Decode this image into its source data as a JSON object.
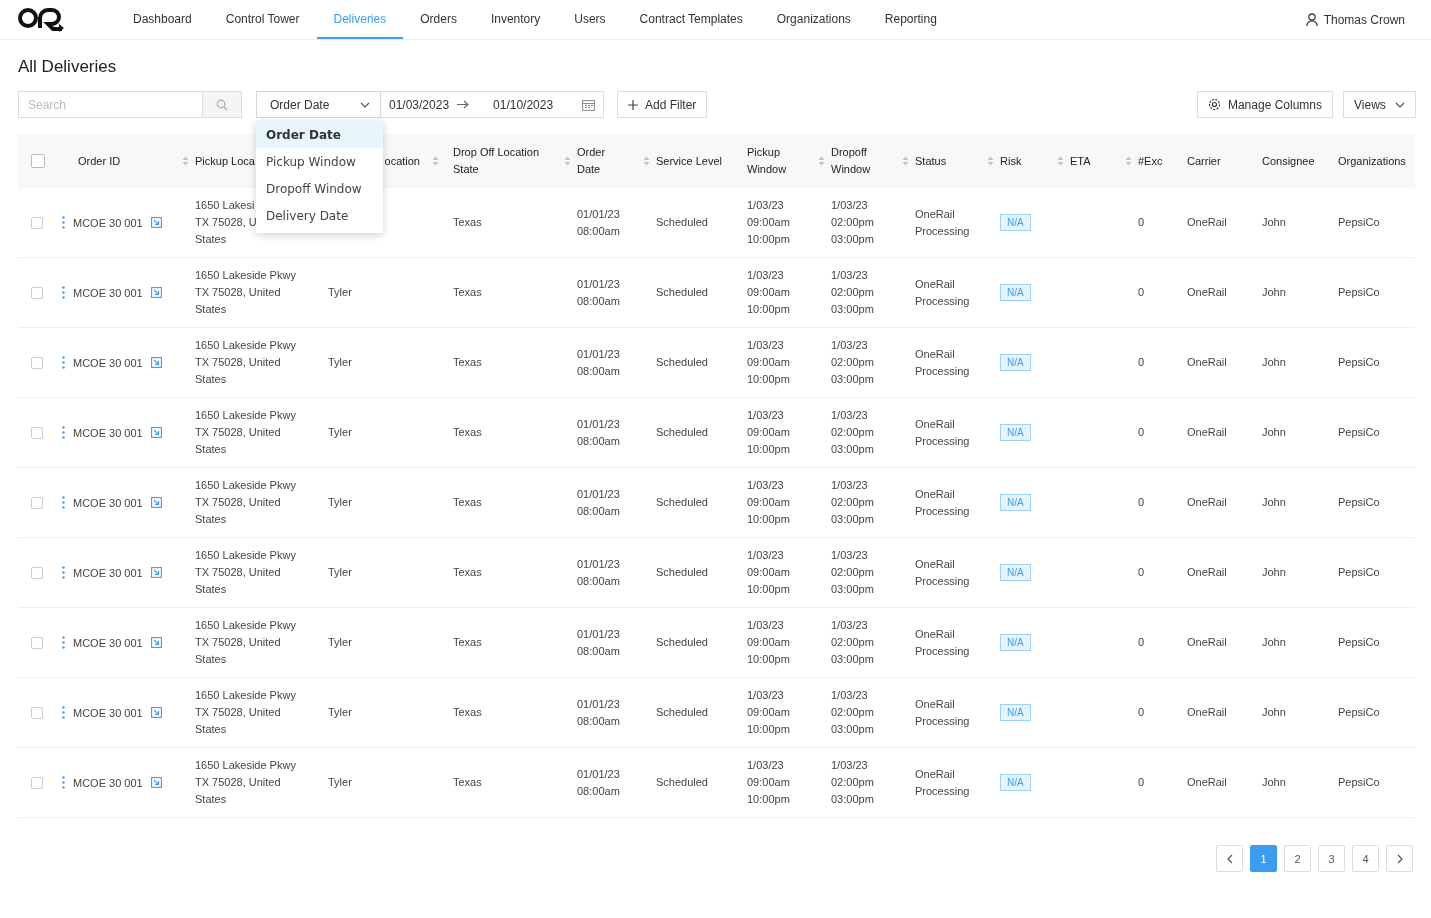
{
  "nav": {
    "items": [
      {
        "label": "Dashboard",
        "selected": false
      },
      {
        "label": "Control Tower",
        "selected": false
      },
      {
        "label": "Deliveries",
        "selected": true
      },
      {
        "label": "Orders",
        "selected": false
      },
      {
        "label": "Inventory",
        "selected": false
      },
      {
        "label": "Users",
        "selected": false
      },
      {
        "label": "Contract Templates",
        "selected": false
      },
      {
        "label": "Organizations",
        "selected": false
      },
      {
        "label": "Reporting",
        "selected": false
      }
    ],
    "user": "Thomas Crown"
  },
  "page_title": "All Deliveries",
  "toolbar": {
    "search": {
      "placeholder": "Search"
    },
    "date_field": {
      "value": "Order Date",
      "expanded": true,
      "options": [
        {
          "label": "Order Date",
          "selected": true
        },
        {
          "label": "Pickup Window",
          "selected": false
        },
        {
          "label": "Dropoff Window",
          "selected": false
        },
        {
          "label": "Delivery Date",
          "selected": false
        }
      ]
    },
    "date_from": "01/03/2023",
    "date_to": "01/10/2023",
    "add_filter": "Add Filter",
    "manage_columns": "Manage Columns",
    "views": "Views"
  },
  "table": {
    "select_all": {
      "checked": false
    },
    "columns": [
      {
        "label": "Order ID",
        "sortable": true,
        "cut": false
      },
      {
        "label": "Pickup Loca",
        "cut": false
      },
      {
        "label": "ocation",
        "sortable": true,
        "cut": true
      },
      {
        "label": "Drop Off Location\nState",
        "sortable": true,
        "cut": false
      },
      {
        "label": "Order\nDate",
        "sortable": true,
        "cut": false
      },
      {
        "label": "Service Level",
        "sortable": false,
        "cut": false
      },
      {
        "label": "Pickup\nWindow",
        "sortable": true,
        "cut": false
      },
      {
        "label": "Dropoff\nWindow",
        "sortable": true,
        "cut": false
      },
      {
        "label": "Status",
        "sortable": true,
        "cut": false
      },
      {
        "label": "Risk",
        "sortable": true,
        "cut": false
      },
      {
        "label": "ETA",
        "sortable": true,
        "cut": false
      },
      {
        "label": "#Exc",
        "sortable": false,
        "cut": false
      },
      {
        "label": "Carrier",
        "sortable": false,
        "cut": false
      },
      {
        "label": "Consignee",
        "sortable": false,
        "cut": false
      },
      {
        "label": "Organizations",
        "sortable": false,
        "cut": false
      }
    ],
    "rows": [
      {
        "selected": false,
        "order_id": "MCOE 30 001",
        "pickup_location": "1650 Lakesi\nTX 75028, U\nStates",
        "pickup_city": "",
        "dropoff_state": "Texas",
        "order_date": "01/01/23\n08:00am",
        "service_level": "Scheduled",
        "pickup_window": "1/03/23\n09:00am\n10:00pm",
        "dropoff_window": "1/03/23\n02:00pm\n03:00pm",
        "status": "OneRail\nProcessing",
        "risk": "N/A",
        "exc": "0",
        "carrier": "OneRail",
        "consignee": "John",
        "organization": "PepsiCo"
      },
      {
        "selected": false,
        "order_id": "MCOE 30 001",
        "pickup_location": "1650 Lakeside Pkwy\nTX 75028, United\nStates",
        "pickup_city": "Tyler",
        "dropoff_state": "Texas",
        "order_date": "01/01/23\n08:00am",
        "service_level": "Scheduled",
        "pickup_window": "1/03/23\n09:00am\n10:00pm",
        "dropoff_window": "1/03/23\n02:00pm\n03:00pm",
        "status": "OneRail\nProcessing",
        "risk": "N/A",
        "exc": "0",
        "carrier": "OneRail",
        "consignee": "John",
        "organization": "PepsiCo"
      },
      {
        "selected": false,
        "order_id": "MCOE 30 001",
        "pickup_location": "1650 Lakeside Pkwy\nTX 75028, United\nStates",
        "pickup_city": "Tyler",
        "dropoff_state": "Texas",
        "order_date": "01/01/23\n08:00am",
        "service_level": "Scheduled",
        "pickup_window": "1/03/23\n09:00am\n10:00pm",
        "dropoff_window": "1/03/23\n02:00pm\n03:00pm",
        "status": "OneRail\nProcessing",
        "risk": "N/A",
        "exc": "0",
        "carrier": "OneRail",
        "consignee": "John",
        "organization": "PepsiCo"
      },
      {
        "selected": false,
        "order_id": "MCOE 30 001",
        "pickup_location": "1650 Lakeside Pkwy\nTX 75028, United\nStates",
        "pickup_city": "Tyler",
        "dropoff_state": "Texas",
        "order_date": "01/01/23\n08:00am",
        "service_level": "Scheduled",
        "pickup_window": "1/03/23\n09:00am\n10:00pm",
        "dropoff_window": "1/03/23\n02:00pm\n03:00pm",
        "status": "OneRail\nProcessing",
        "risk": "N/A",
        "exc": "0",
        "carrier": "OneRail",
        "consignee": "John",
        "organization": "PepsiCo"
      },
      {
        "selected": false,
        "order_id": "MCOE 30 001",
        "pickup_location": "1650 Lakeside Pkwy\nTX 75028, United\nStates",
        "pickup_city": "Tyler",
        "dropoff_state": "Texas",
        "order_date": "01/01/23\n08:00am",
        "service_level": "Scheduled",
        "pickup_window": "1/03/23\n09:00am\n10:00pm",
        "dropoff_window": "1/03/23\n02:00pm\n03:00pm",
        "status": "OneRail\nProcessing",
        "risk": "N/A",
        "exc": "0",
        "carrier": "OneRail",
        "consignee": "John",
        "organization": "PepsiCo"
      },
      {
        "selected": false,
        "order_id": "MCOE 30 001",
        "pickup_location": "1650 Lakeside Pkwy\nTX 75028, United\nStates",
        "pickup_city": "Tyler",
        "dropoff_state": "Texas",
        "order_date": "01/01/23\n08:00am",
        "service_level": "Scheduled",
        "pickup_window": "1/03/23\n09:00am\n10:00pm",
        "dropoff_window": "1/03/23\n02:00pm\n03:00pm",
        "status": "OneRail\nProcessing",
        "risk": "N/A",
        "exc": "0",
        "carrier": "OneRail",
        "consignee": "John",
        "organization": "PepsiCo"
      },
      {
        "selected": false,
        "order_id": "MCOE 30 001",
        "pickup_location": "1650 Lakeside Pkwy\nTX 75028, United\nStates",
        "pickup_city": "Tyler",
        "dropoff_state": "Texas",
        "order_date": "01/01/23\n08:00am",
        "service_level": "Scheduled",
        "pickup_window": "1/03/23\n09:00am\n10:00pm",
        "dropoff_window": "1/03/23\n02:00pm\n03:00pm",
        "status": "OneRail\nProcessing",
        "risk": "N/A",
        "exc": "0",
        "carrier": "OneRail",
        "consignee": "John",
        "organization": "PepsiCo"
      },
      {
        "selected": false,
        "order_id": "MCOE 30 001",
        "pickup_location": "1650 Lakeside Pkwy\nTX 75028, United\nStates",
        "pickup_city": "Tyler",
        "dropoff_state": "Texas",
        "order_date": "01/01/23\n08:00am",
        "service_level": "Scheduled",
        "pickup_window": "1/03/23\n09:00am\n10:00pm",
        "dropoff_window": "1/03/23\n02:00pm\n03:00pm",
        "status": "OneRail\nProcessing",
        "risk": "N/A",
        "exc": "0",
        "carrier": "OneRail",
        "consignee": "John",
        "organization": "PepsiCo"
      },
      {
        "selected": false,
        "order_id": "MCOE 30 001",
        "pickup_location": "1650 Lakeside Pkwy\nTX 75028, United\nStates",
        "pickup_city": "Tyler",
        "dropoff_state": "Texas",
        "order_date": "01/01/23\n08:00am",
        "service_level": "Scheduled",
        "pickup_window": "1/03/23\n09:00am\n10:00pm",
        "dropoff_window": "1/03/23\n02:00pm\n03:00pm",
        "status": "OneRail\nProcessing",
        "risk": "N/A",
        "exc": "0",
        "carrier": "OneRail",
        "consignee": "John",
        "organization": "PepsiCo"
      }
    ]
  },
  "pagination": {
    "pages": [
      {
        "label": "1",
        "selected": true
      },
      {
        "label": "2",
        "selected": false
      },
      {
        "label": "3",
        "selected": false
      },
      {
        "label": "4",
        "selected": false
      }
    ]
  }
}
